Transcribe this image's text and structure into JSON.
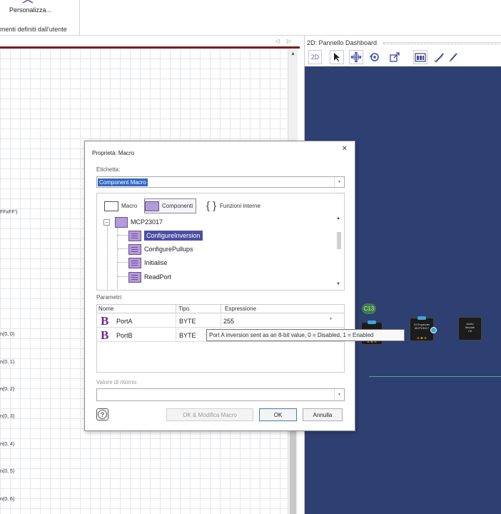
{
  "ribbon": {
    "customize_label": "Personalizza...",
    "group_label": "menti definiti dall'utente"
  },
  "code_panel": {
    "lines": [
      {
        "text": "FFxFF')"
      },
      {
        "text": "n(0, 0)"
      },
      {
        "text": "n(0, 1)"
      },
      {
        "text": "n(0, 2)"
      },
      {
        "text": "n(0, 3)"
      },
      {
        "text": "n(0, 4)"
      },
      {
        "text": "n(0, 5)"
      },
      {
        "text": "n(0, 6)"
      }
    ]
  },
  "dashboard": {
    "title": "2D: Pannello Dashboard",
    "tool_2d": "2D",
    "component_label": "C13",
    "chips": [
      {
        "line1": "IO Expander",
        "line2": "MCP23017",
        "line3": ""
      },
      {
        "line1": "Audio",
        "line2": "Module",
        "line3": "C6"
      }
    ],
    "colors": {
      "canvas": "#2e3f72"
    }
  },
  "dialog": {
    "title": "Proprietà: Macro",
    "label_caption": "Etichetta:",
    "label_value": "Component Macro",
    "tabs": [
      {
        "label": "Macro",
        "active": false
      },
      {
        "label": "Componenti",
        "active": true
      },
      {
        "label": "Funzioni interne",
        "active": false
      }
    ],
    "tree": {
      "root": "MCP23017",
      "items": [
        "ConfigureInversion",
        "ConfigurePullups",
        "Initialise",
        "ReadPort"
      ],
      "selected": "ConfigureInversion"
    },
    "params_caption": "Parametri:",
    "params_columns": [
      "Nome",
      "Tipo",
      "Espressione"
    ],
    "params": [
      {
        "name": "PortA",
        "type": "BYTE",
        "expr": "255"
      },
      {
        "name": "PortB",
        "type": "BYTE",
        "expr": ""
      }
    ],
    "tooltip": "Port A inversion sent as an 8-bit value, 0 = Disabled, 1 = Enabled",
    "return_caption": "Valore di ritorno:",
    "buttons": {
      "ok_modify": "OK & Modifica Macro",
      "ok": "OK",
      "cancel": "Annulla"
    }
  }
}
